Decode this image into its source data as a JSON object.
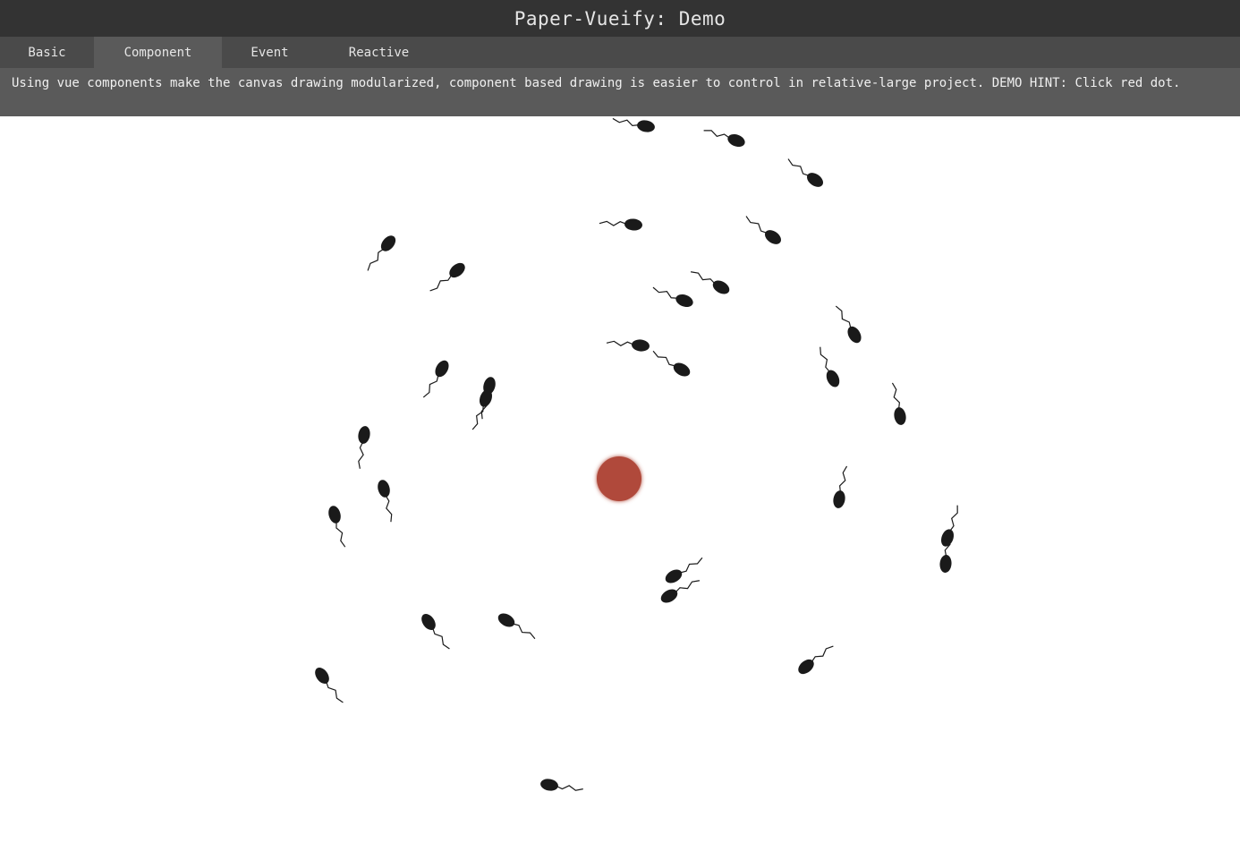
{
  "app": {
    "title": "Paper-Vueify: Demo"
  },
  "tabs": [
    {
      "label": "Basic",
      "active": false
    },
    {
      "label": "Component",
      "active": true
    },
    {
      "label": "Event",
      "active": false
    },
    {
      "label": "Reactive",
      "active": false
    }
  ],
  "hint": {
    "text": "Using vue components make the canvas drawing modularized, component based drawing is easier to control in relative-large project. DEMO HINT: Click red dot."
  },
  "canvas": {
    "red_dot_color": "#b04a3a",
    "swimmer_color": "#1a1a1a",
    "swimmer_count": 33
  }
}
